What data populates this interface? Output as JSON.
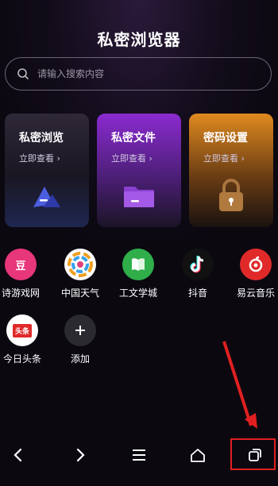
{
  "header": {
    "title": "私密浏览器"
  },
  "search": {
    "placeholder": "请输入搜索内容"
  },
  "cards": [
    {
      "title": "私密浏览",
      "sub": "立即查看 ›"
    },
    {
      "title": "私密文件",
      "sub": "立即查看 ›"
    },
    {
      "title": "密码设置",
      "sub": "立即查看 ›"
    }
  ],
  "shortcuts": [
    {
      "label": "诗游戏网",
      "icon": "douban-icon",
      "bg": "#e8367a"
    },
    {
      "label": "中国天气",
      "icon": "weather-icon",
      "bg": "#ffffff"
    },
    {
      "label": "工文学城",
      "icon": "book-icon",
      "bg": "#2fae4a"
    },
    {
      "label": "抖音",
      "icon": "tiktok-icon",
      "bg": "#111111"
    },
    {
      "label": "易云音乐",
      "icon": "netease-music-icon",
      "bg": "#e02a2a"
    },
    {
      "label": "今日头条",
      "icon": "toutiao-icon",
      "bg": "#ffffff",
      "badge": "头条"
    },
    {
      "label": "添加",
      "icon": "add-icon",
      "bg": "#2b2a30"
    }
  ],
  "colors": {
    "accent": "#e02020",
    "background": "#0b0810"
  }
}
